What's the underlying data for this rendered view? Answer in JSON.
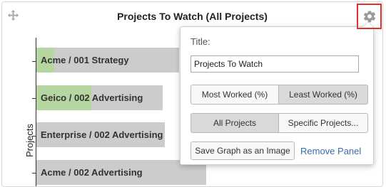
{
  "panel": {
    "title": "Projects To Watch (All Projects)",
    "move_icon": "move-arrows-icon",
    "gear_icon": "gear-icon",
    "highlight_color": "#e03030"
  },
  "chart_data": {
    "type": "bar",
    "orientation": "horizontal",
    "ylabel": "Projects",
    "categories": [
      "Acme / 001 Strategy",
      "Geico / 002 Advertising",
      "Enterprise / 002 Advertising",
      "Acme / 002 Advertising"
    ],
    "colors": {
      "bar": "#cccccc",
      "highlight": "#b5d6a0"
    }
  },
  "popover": {
    "title_label": "Title:",
    "title_value": "Projects To Watch",
    "sort_buttons": [
      {
        "label": "Most Worked (%)",
        "active": false
      },
      {
        "label": "Least Worked (%)",
        "active": true
      }
    ],
    "scope_buttons": [
      {
        "label": "All Projects",
        "active": true
      },
      {
        "label": "Specific Projects...",
        "active": false
      }
    ],
    "save_label": "Save Graph as an Image",
    "remove_label": "Remove Panel",
    "link_color": "#3a6ea5"
  }
}
